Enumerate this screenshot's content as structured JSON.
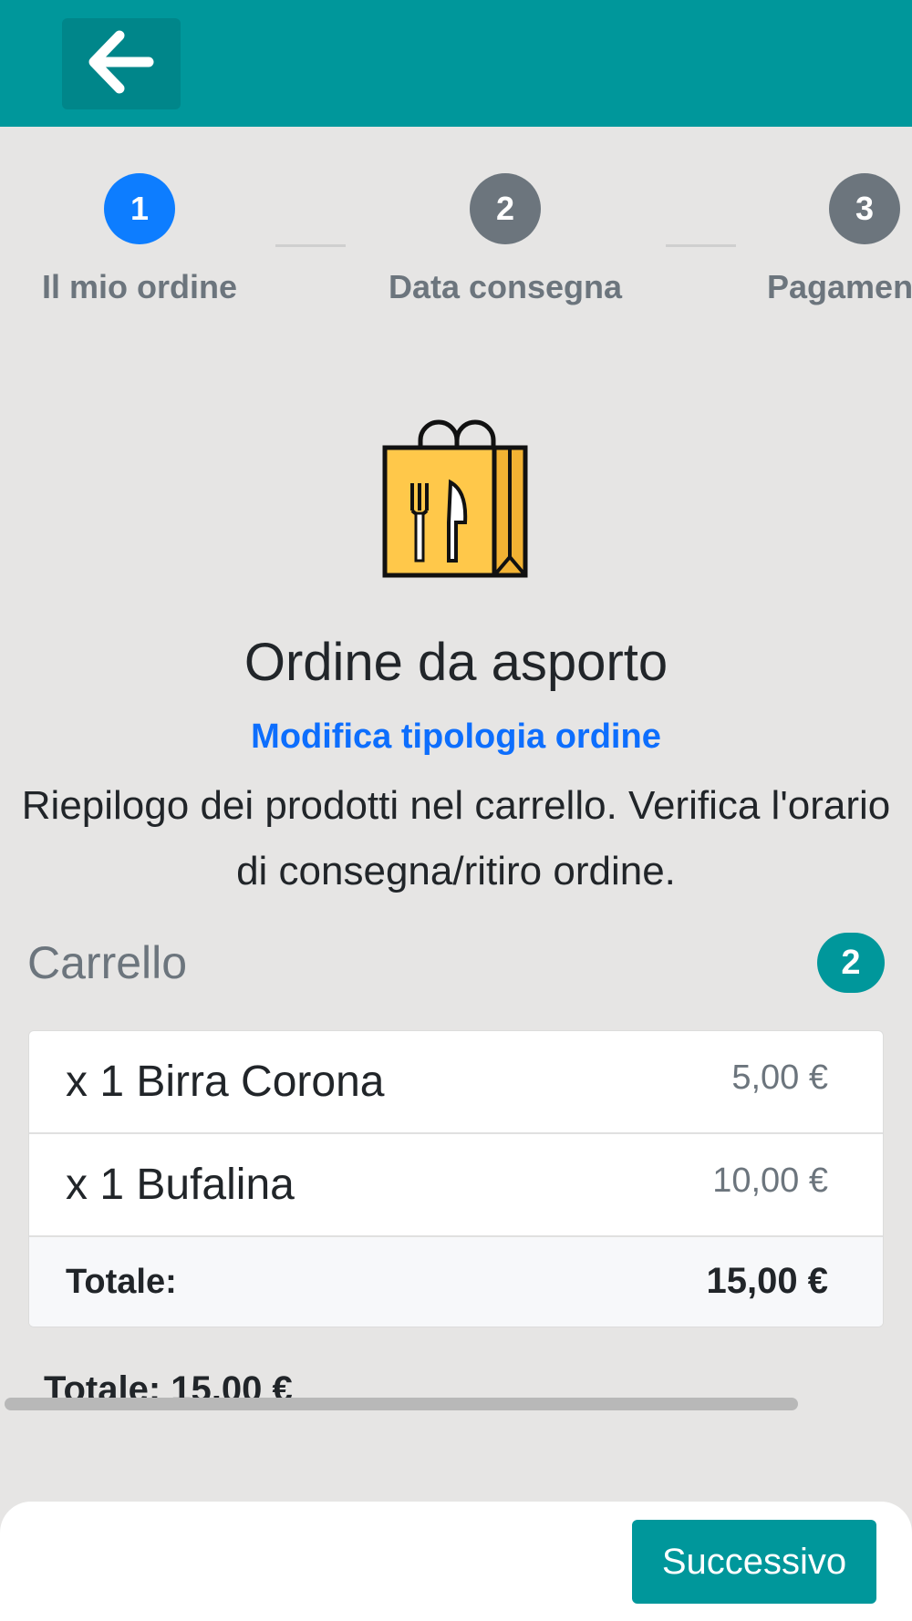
{
  "header": {
    "back_icon": "arrow-left-icon"
  },
  "stepper": {
    "steps": [
      {
        "number": "1",
        "label": "Il mio ordine",
        "state": "active"
      },
      {
        "number": "2",
        "label": "Data consegna",
        "state": "inactive"
      },
      {
        "number": "3",
        "label": "Pagamen",
        "state": "inactive"
      }
    ]
  },
  "order": {
    "icon": "takeaway-bag-icon",
    "title": "Ordine da asporto",
    "modify_link": "Modifica tipologia ordine",
    "summary": "Riepilogo dei prodotti nel carrello. Verifica l'orario di consegna/ritiro ordine."
  },
  "cart": {
    "title": "Carrello",
    "count": "2",
    "items": [
      {
        "name": "x 1 Birra Corona",
        "price": "5,00 €"
      },
      {
        "name": "x 1 Bufalina",
        "price": "10,00 €"
      }
    ],
    "total_label": "Totale:",
    "total_value": "15,00 €"
  },
  "bottom_total": "Totale: 15,00 €",
  "footer": {
    "next_label": "Successivo"
  },
  "colors": {
    "accent": "#00979b",
    "active_step": "#0d7dff",
    "link": "#0d6efd"
  }
}
